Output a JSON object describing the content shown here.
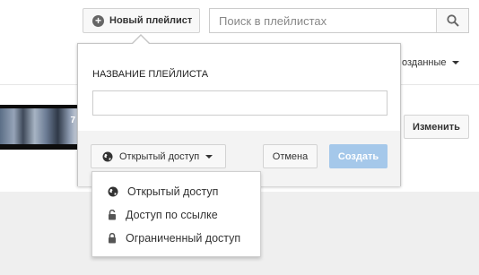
{
  "header": {
    "new_playlist_label": "Новый плейлист",
    "search_placeholder": "Поиск в плейлистах"
  },
  "sort": {
    "label": "озданные"
  },
  "thumbnail": {
    "badge": "7"
  },
  "edit_button_label": "Изменить",
  "popup": {
    "title": "НАЗВАНИЕ ПЛЕЙЛИСТА",
    "name_value": "",
    "privacy_selected": "Открытый доступ",
    "cancel_label": "Отмена",
    "create_label": "Создать"
  },
  "privacy_options": [
    {
      "label": "Открытый доступ",
      "icon": "globe-icon"
    },
    {
      "label": "Доступ по ссылке",
      "icon": "unlock-icon"
    },
    {
      "label": "Ограниченный доступ",
      "icon": "lock-icon"
    }
  ],
  "colors": {
    "accent_disabled": "#a5c8ea",
    "footer_bg": "#f3f3f3",
    "page_gray": "#efefef"
  }
}
